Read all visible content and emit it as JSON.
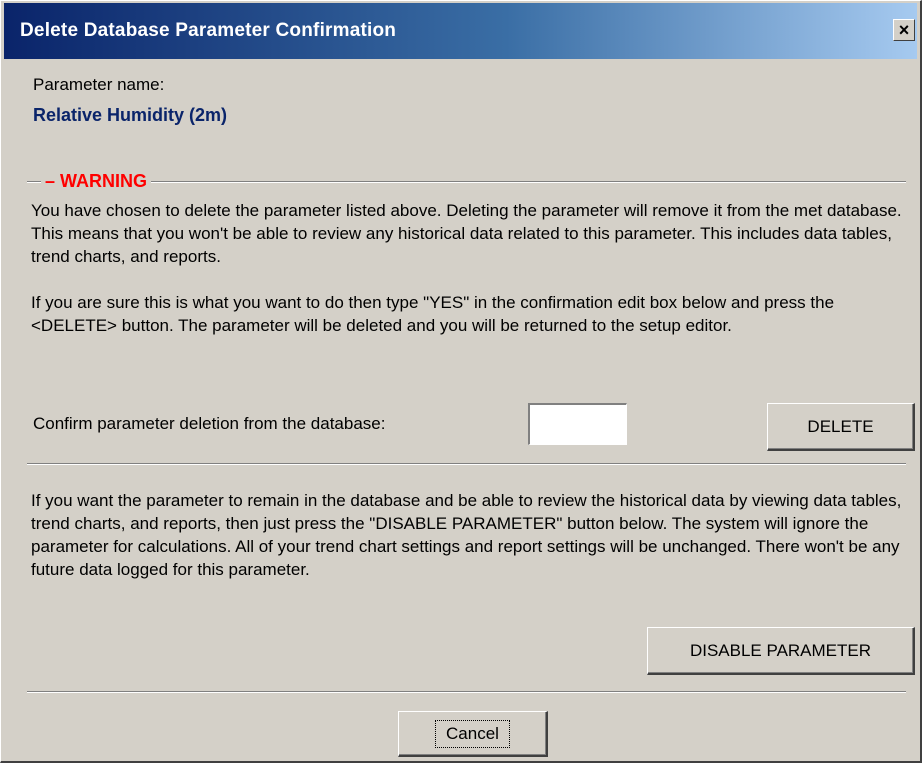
{
  "window": {
    "title": "Delete Database Parameter Confirmation",
    "close_symbol": "×"
  },
  "parameter": {
    "label": "Parameter name:",
    "value": "Relative Humidity (2m)"
  },
  "warning": {
    "title": "WARNING",
    "paragraph1": "You have chosen to delete the parameter listed above.  Deleting the parameter will remove it from the met database.  This means that you won't be able to review any historical data related to this parameter.  This includes data tables, trend charts, and reports.",
    "paragraph2": "If you are sure this is what you want to do then type \"YES\" in the confirmation edit box below and press the <DELETE> button.  The parameter will be deleted and you will be returned to the setup editor."
  },
  "confirm": {
    "label": "Confirm parameter deletion from the database:",
    "input_value": "",
    "delete_label": "DELETE"
  },
  "disable": {
    "paragraph": "If you want the parameter to remain in the database and be able to review the historical data by viewing data tables, trend charts, and reports, then just press the \"DISABLE PARAMETER\" button below.  The system will ignore the parameter for calculations.  All of your trend chart settings and report settings will be unchanged.  There won't be any future data logged for this parameter.",
    "button_label": "DISABLE PARAMETER"
  },
  "footer": {
    "cancel_label": "Cancel"
  },
  "colors": {
    "title_gradient_start": "#0a246a",
    "title_gradient_end": "#a6caf0",
    "warning": "#ff0000",
    "param_value": "#0a246a",
    "dialog_bg": "#d4d0c8"
  }
}
